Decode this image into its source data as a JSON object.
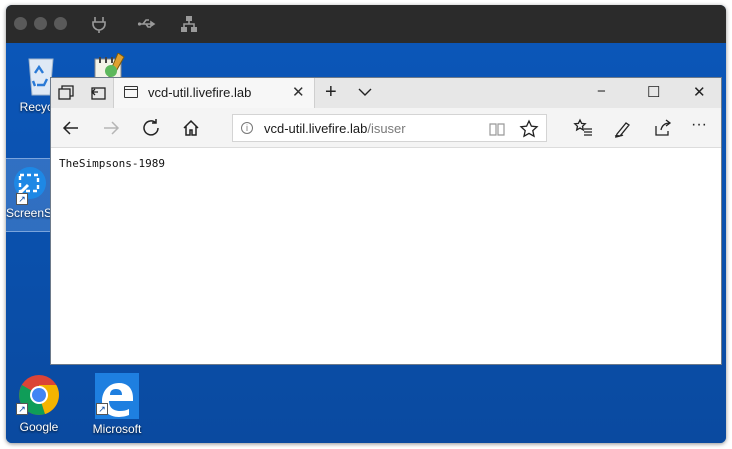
{
  "desktop": {
    "icons": [
      {
        "label": "Recycle",
        "icon": "recycle-bin-icon"
      },
      {
        "label": "ScreenS",
        "icon": "screen-sketch-icon"
      },
      {
        "label": "Google",
        "icon": "chrome-icon"
      },
      {
        "label": "Microsoft",
        "icon": "edge-icon"
      }
    ]
  },
  "browser": {
    "tab": {
      "title": "vcd-util.livefire.lab"
    },
    "address": {
      "host": "vcd-util.livefire.lab",
      "path": "/isuser"
    },
    "window_controls": {
      "minimize": "−",
      "maximize": "☐",
      "close": "✕"
    }
  },
  "page": {
    "text": "TheSimpsons-1989"
  },
  "colors": {
    "desktop": "#0a4ea6",
    "vm_toolbar": "#2b2b2b",
    "tab_bar": "#e7e7e7"
  }
}
